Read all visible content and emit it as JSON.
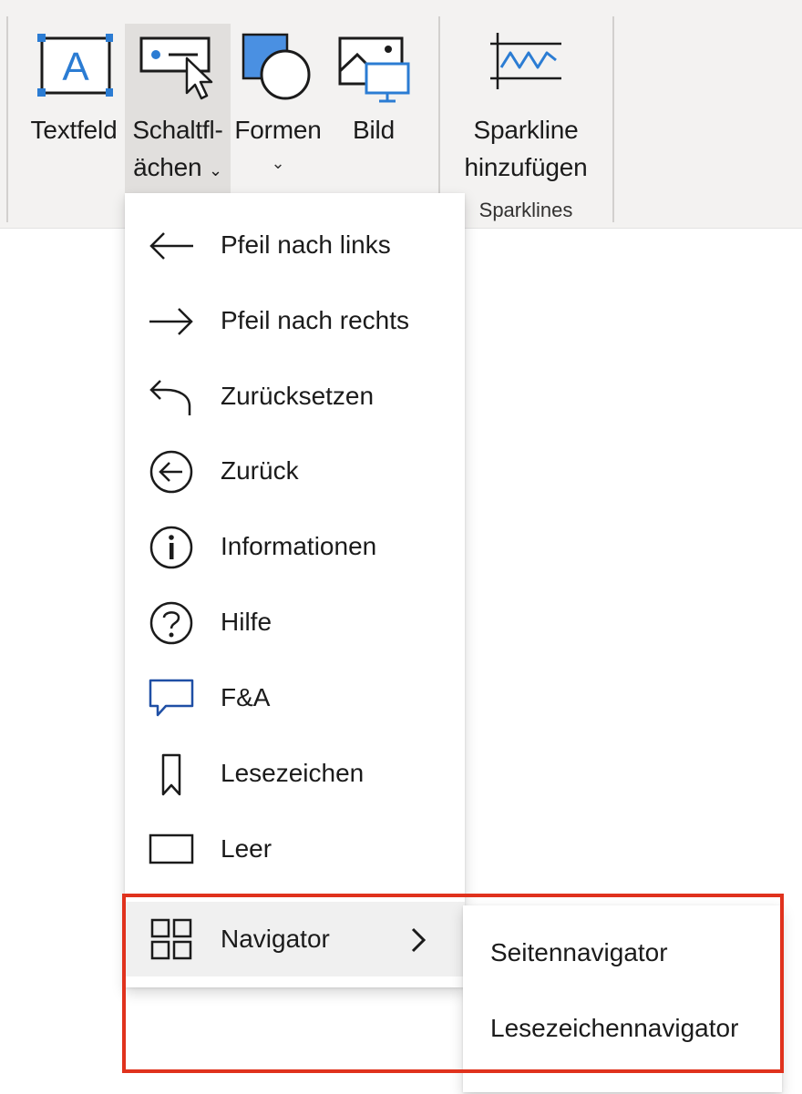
{
  "ribbon": {
    "buttons": [
      {
        "label": "Textfeld",
        "icon": "textbox-icon"
      },
      {
        "label_line1": "Schaltfl-",
        "label_line2": "ächen",
        "icon": "button-control-icon",
        "chevron": "⌄"
      },
      {
        "label": "Formen",
        "icon": "shapes-icon",
        "chevron": "⌄"
      },
      {
        "label": "Bild",
        "icon": "picture-icon"
      },
      {
        "label_line1": "Sparkline",
        "label_line2": "hinzufügen",
        "icon": "sparkline-icon"
      }
    ],
    "groups": {
      "sparklines": "Sparklines"
    }
  },
  "menu": {
    "items": [
      {
        "label": "Pfeil nach links",
        "icon": "arrow-left-icon"
      },
      {
        "label": "Pfeil nach rechts",
        "icon": "arrow-right-icon"
      },
      {
        "label": "Zurücksetzen",
        "icon": "reset-icon"
      },
      {
        "label": "Zurück",
        "icon": "back-circle-icon"
      },
      {
        "label": "Informationen",
        "icon": "info-icon"
      },
      {
        "label": "Hilfe",
        "icon": "help-icon"
      },
      {
        "label": "F&A",
        "icon": "qa-speech-bubble-icon"
      },
      {
        "label": "Lesezeichen",
        "icon": "bookmark-icon"
      },
      {
        "label": "Leer",
        "icon": "blank-rectangle-icon"
      },
      {
        "label": "Navigator",
        "icon": "navigator-grid-icon"
      }
    ]
  },
  "submenu": {
    "items": [
      {
        "label": "Seitennavigator"
      },
      {
        "label": "Lesezeichennavigator"
      }
    ]
  },
  "colors": {
    "ribbon_bg": "#f3f2f1",
    "accent_blue": "#2b7cd3",
    "shape_fill": "#4a90e2",
    "highlight_box": "#e0321d",
    "qa_icon": "#1f4fa5"
  }
}
